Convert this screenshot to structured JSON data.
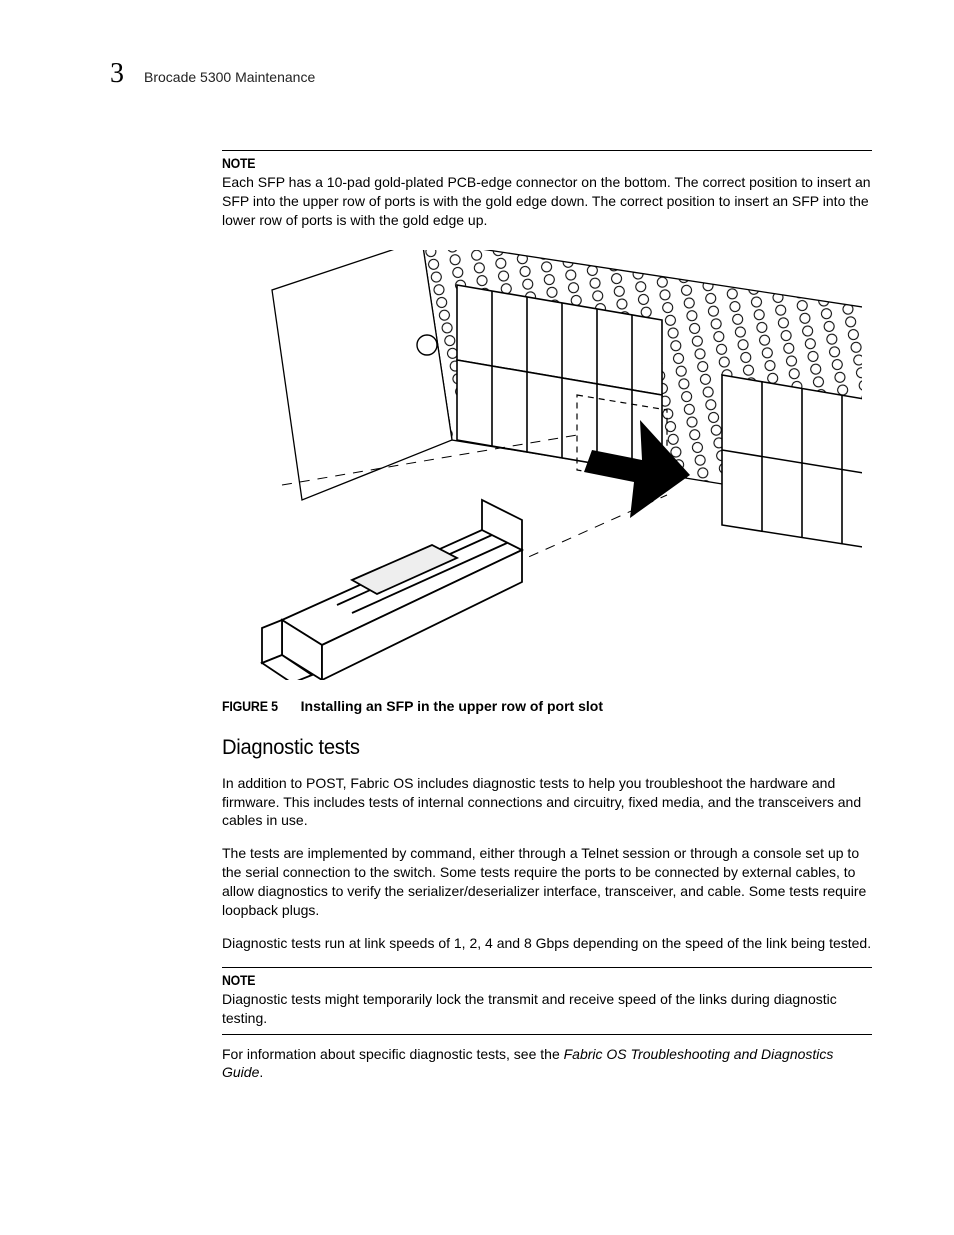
{
  "header": {
    "chapter_number": "3",
    "chapter_title": "Brocade 5300 Maintenance"
  },
  "note1": {
    "label": "NOTE",
    "text": "Each SFP has a 10-pad gold-plated PCB-edge connector on the bottom. The correct position to insert an SFP into the upper row of ports is with the gold edge down. The correct position to insert an SFP into the lower row of ports is with the gold edge up."
  },
  "figure": {
    "label": "FIGURE 5",
    "caption": "Installing an SFP in the upper row of port slot",
    "alt": "diagram-sfp-insert-upper-row"
  },
  "section": {
    "heading": "Diagnostic tests",
    "p1": "In addition to POST, Fabric OS includes diagnostic tests to help you troubleshoot the hardware and firmware. This includes tests of internal connections and circuitry, fixed media, and the transceivers and cables in use.",
    "p2": "The tests are implemented by command, either through a Telnet session or through a console set up to the serial connection to the switch. Some tests require the ports to be connected by external cables, to allow diagnostics to verify the serializer/deserializer interface, transceiver, and cable. Some tests require loopback plugs.",
    "p3": "Diagnostic tests run at link speeds of 1, 2, 4 and 8 Gbps depending on the speed of the link being tested."
  },
  "note2": {
    "label": "NOTE",
    "text": "Diagnostic tests might temporarily lock the transmit and receive speed of the links during diagnostic testing."
  },
  "closing": {
    "prefix": "For information about specific diagnostic tests, see the ",
    "ref": "Fabric OS Troubleshooting and Diagnostics Guide",
    "suffix": "."
  }
}
